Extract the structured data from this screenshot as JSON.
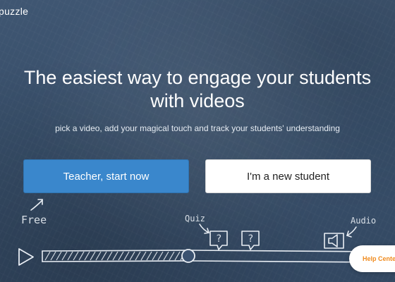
{
  "header": {
    "logo_text": "puzzle"
  },
  "hero": {
    "headline_line1": "The easiest way to engage your students",
    "headline_line2": "with videos",
    "subtitle": "pick a video, add your magical touch and track your students' understanding"
  },
  "actions": {
    "teacher_label": "Teacher, start now",
    "student_label": "I'm a new student"
  },
  "illustration": {
    "free_label": "Free",
    "quiz_label": "Quiz",
    "audio_label": "Audio",
    "quiz_marker_glyph": "?"
  },
  "help": {
    "label": "Help Cente"
  },
  "colors": {
    "background": "#3b5270",
    "teacher_button": "#3a87cc",
    "student_button": "#ffffff",
    "help_text": "#f08a1c"
  },
  "icons": [
    "play-icon",
    "speaker-icon",
    "question-bubble-icon",
    "arrow-icon"
  ]
}
